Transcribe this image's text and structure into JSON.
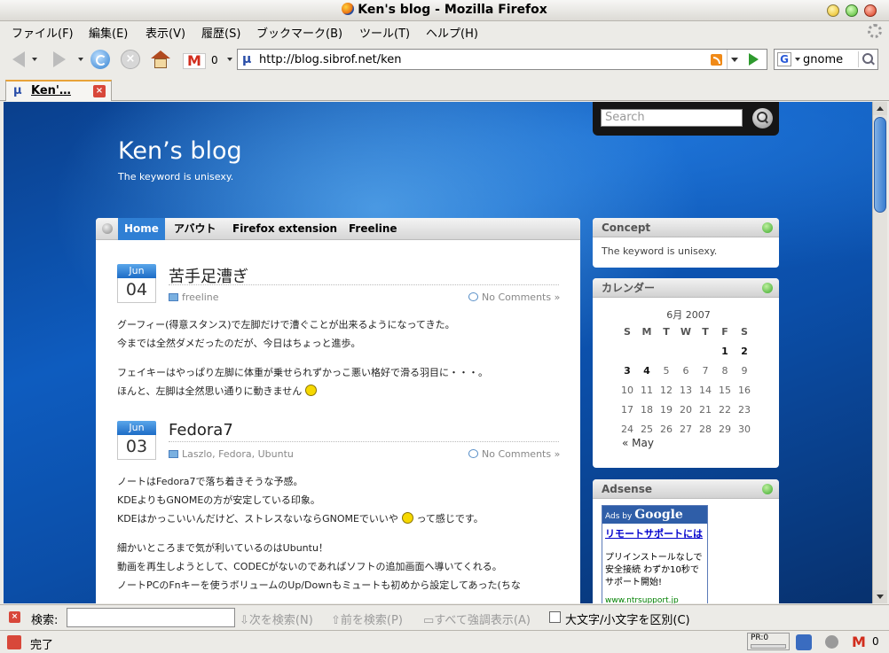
{
  "window": {
    "title": "Ken's blog - Mozilla Firefox"
  },
  "menu": [
    "ファイル(F)",
    "編集(E)",
    "表示(V)",
    "履歴(S)",
    "ブックマーク(B)",
    "ツール(T)",
    "ヘルプ(H)"
  ],
  "toolbar": {
    "gmail_count": "0",
    "url": "http://blog.sibrof.net/ken",
    "search_engine_icon": "G",
    "search_value": "gnome"
  },
  "tabs": [
    {
      "label": "Ken'…",
      "icon": "μ"
    }
  ],
  "site_icon": "μ",
  "blog": {
    "title": "Ken’s  blog",
    "subtitle": "The  keyword  is  unisexy.",
    "search_placeholder": "Search",
    "nav": [
      "Home",
      "アバウト",
      "Firefox  extension",
      "Freeline"
    ],
    "posts": [
      {
        "month": "Jun",
        "day": "04",
        "title": "苦手足漕ぎ",
        "category": "freeline",
        "comments": "No  Comments  »",
        "paragraphs": [
          [
            "グーフィー(得意スタンス)で左脚だけで漕ぐことが出来るようになってきた。",
            "今までは全然ダメだったのだが、今日はちょっと進歩。"
          ],
          [
            "フェイキーはやっぱり左脚に体重が乗せられずかっこ悪い格好で滑る羽目に・・・。",
            "ほんと、左脚は全然思い通りに動きません"
          ]
        ]
      },
      {
        "month": "Jun",
        "day": "03",
        "title": "Fedora7",
        "category": "Laszlo,  Fedora,  Ubuntu",
        "comments": "No  Comments  »",
        "paragraphs": [
          [
            "ノートはFedora7で落ち着きそうな予感。",
            "KDEよりもGNOMEの方が安定している印象。",
            "KDEはかっこいいんだけど、ストレスないならGNOMEでいいや",
            "って感じです。"
          ],
          [
            "細かいところまで気が利いているのはUbuntu！",
            "動画を再生しようとして、CODECがないのであればソフトの追加画面へ導いてくれる。",
            "ノートPCのFnキーを使うボリュームのUp/Downもミュートも初めから設定してあった(ちな"
          ]
        ]
      }
    ]
  },
  "sidebar": {
    "concept": {
      "title": "Concept",
      "text": "The  keyword  is  unisexy."
    },
    "calendar": {
      "title": "カレンダー",
      "caption": "6月  2007",
      "weekdays": [
        "S",
        "M",
        "T",
        "W",
        "T",
        "F",
        "S"
      ],
      "weeks": [
        [
          "",
          "",
          "",
          "",
          "",
          "1",
          "2"
        ],
        [
          "3",
          "4",
          "5",
          "6",
          "7",
          "8",
          "9"
        ],
        [
          "10",
          "11",
          "12",
          "13",
          "14",
          "15",
          "16"
        ],
        [
          "17",
          "18",
          "19",
          "20",
          "21",
          "22",
          "23"
        ],
        [
          "24",
          "25",
          "26",
          "27",
          "28",
          "29",
          "30"
        ]
      ],
      "prev": "«  May"
    },
    "adsense": {
      "title": "Adsense",
      "ads_by": "Ads by",
      "google": "Google",
      "link": "リモートサポートには",
      "text": "プリインストールなしで安全接続 わずか10秒でサポート開始!",
      "url": "www.ntrsupport.jp"
    }
  },
  "findbar": {
    "label": "検索:",
    "next": "次を検索(N)",
    "prev": "前を検索(P)",
    "highlight": "すべて強調表示(A)",
    "case": "大文字/小文字を区別(C)"
  },
  "status": {
    "text": "完了",
    "pr": "PR:0",
    "gmail_count": "0"
  }
}
